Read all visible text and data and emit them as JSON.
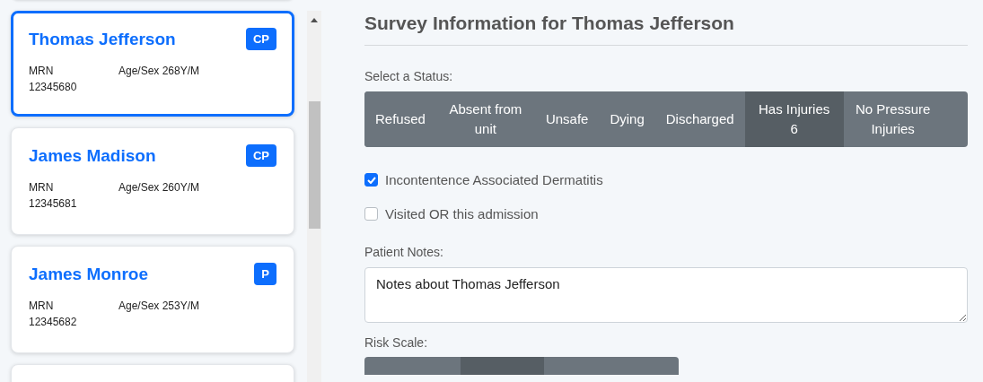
{
  "patients": [
    {
      "name": "Thomas Jefferson",
      "badge": "CP",
      "mrn_label": "MRN",
      "mrn": "12345680",
      "age_sex": "Age/Sex 268Y/M",
      "selected": true
    },
    {
      "name": "James Madison",
      "badge": "CP",
      "mrn_label": "MRN",
      "mrn": "12345681",
      "age_sex": "Age/Sex 260Y/M",
      "selected": false
    },
    {
      "name": "James Monroe",
      "badge": "P",
      "mrn_label": "MRN",
      "mrn": "12345682",
      "age_sex": "Age/Sex 253Y/M",
      "selected": false
    }
  ],
  "survey": {
    "title": "Survey Information for Thomas Jefferson",
    "status_label": "Select a Status:",
    "statuses": [
      {
        "label": "Refused",
        "selected": false
      },
      {
        "label": "Absent from unit",
        "selected": false
      },
      {
        "label": "Unsafe",
        "selected": false
      },
      {
        "label": "Dying",
        "selected": false
      },
      {
        "label": "Discharged",
        "selected": false
      },
      {
        "label": "Has Injuries 6",
        "selected": true
      },
      {
        "label": "No Pressure Injuries",
        "selected": false
      }
    ],
    "checkboxes": [
      {
        "label": "Incontentence Associated Dermatitis",
        "checked": true
      },
      {
        "label": "Visited OR this admission",
        "checked": false
      }
    ],
    "notes_label": "Patient Notes:",
    "notes": "Notes about Thomas Jefferson",
    "risk_label": "Risk Scale:",
    "risk_options": [
      {
        "selected": false
      },
      {
        "selected": true
      },
      {
        "selected": false
      }
    ]
  }
}
